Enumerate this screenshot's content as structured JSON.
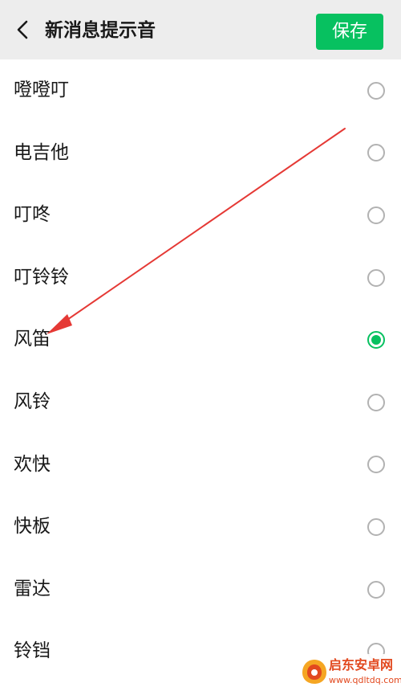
{
  "header": {
    "title": "新消息提示音",
    "save_label": "保存"
  },
  "sounds": [
    {
      "label": "噔噔叮",
      "selected": false
    },
    {
      "label": "电吉他",
      "selected": false
    },
    {
      "label": "叮咚",
      "selected": false
    },
    {
      "label": "叮铃铃",
      "selected": false
    },
    {
      "label": "风笛",
      "selected": true
    },
    {
      "label": "风铃",
      "selected": false
    },
    {
      "label": "欢快",
      "selected": false
    },
    {
      "label": "快板",
      "selected": false
    },
    {
      "label": "雷达",
      "selected": false
    },
    {
      "label": "铃铛",
      "selected": false
    }
  ],
  "watermark": {
    "name": "启东安卓网",
    "url": "www.qdltdq.com"
  },
  "colors": {
    "accent": "#07c160",
    "header_bg": "#ededed",
    "annotation_arrow": "#e53935",
    "watermark": "#e2491f"
  },
  "icons": {
    "back": "chevron-left-icon",
    "radio_on": "radio-checked-icon",
    "radio_off": "radio-unchecked-icon"
  }
}
